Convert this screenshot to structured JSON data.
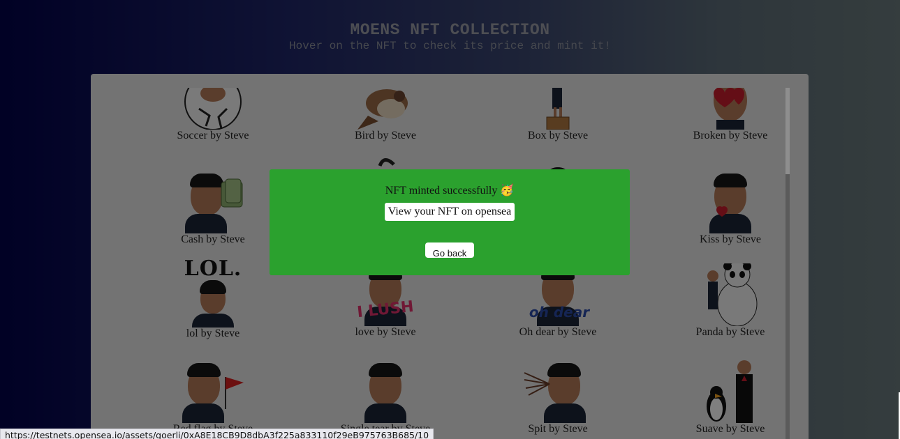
{
  "header": {
    "title": "MOENS NFT COLLECTION",
    "subtitle": "Hover on the NFT to check its price and mint it!"
  },
  "nfts": [
    {
      "name": "Soccer by Steve",
      "icon": "soccer-ball-figure"
    },
    {
      "name": "Bird by Steve",
      "icon": "sparrow"
    },
    {
      "name": "Box by Steve",
      "icon": "figure-on-box"
    },
    {
      "name": "Broken by Steve",
      "icon": "broken-heart-eyes"
    },
    {
      "name": "Cash by Steve",
      "icon": "money-figure"
    },
    {
      "name": "",
      "icon": "hidden"
    },
    {
      "name": "",
      "icon": "hidden"
    },
    {
      "name": "Kiss by Steve",
      "icon": "kiss-figure"
    },
    {
      "name": "lol by Steve",
      "icon": "lol-figure"
    },
    {
      "name": "love by Steve",
      "icon": "ilush-figure"
    },
    {
      "name": "Oh dear by Steve",
      "icon": "oh-dear-figure"
    },
    {
      "name": "Panda by Steve",
      "icon": "panda-figure"
    },
    {
      "name": "Red flag by Steve",
      "icon": "red-flag-figure"
    },
    {
      "name": "Single tear by Steve",
      "icon": "tear-figure"
    },
    {
      "name": "Spit by Steve",
      "icon": "spit-figure"
    },
    {
      "name": "Suave by Steve",
      "icon": "penguin-figure"
    }
  ],
  "art_text": {
    "lol": "LOL.",
    "love": "I LUSH",
    "oh_dear": "oh dear"
  },
  "modal": {
    "message": "NFT minted successfully 🥳",
    "link_label": "View your NFT on opensea",
    "back_label": "Go back"
  },
  "status_bar": {
    "url": "https://testnets.opensea.io/assets/goerli/0xA8E18CB9D8dbA3f225a833110f29eB975763B685/10"
  },
  "colors": {
    "modal_bg": "#2ba12e",
    "panel_bg": "#e6e6e6"
  }
}
